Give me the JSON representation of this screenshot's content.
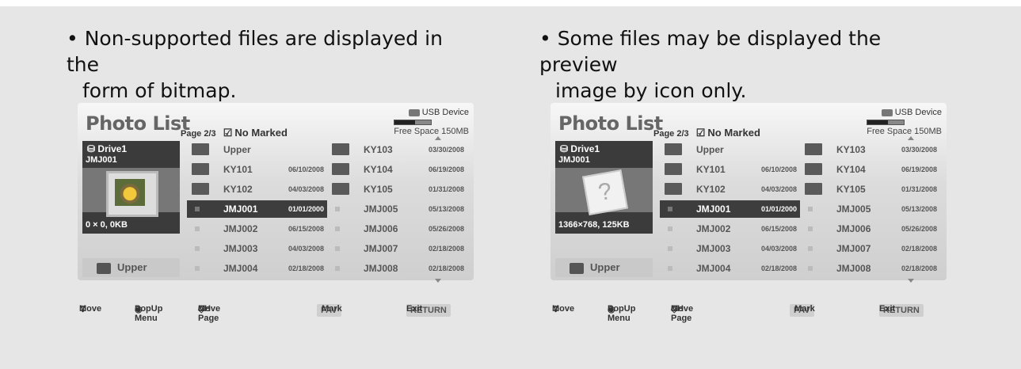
{
  "left": {
    "bullet_line1": "• Non-supported files are displayed in the",
    "bullet_line2": "form of bitmap.",
    "preview": {
      "drive": "Drive1",
      "file": "JMJ001",
      "info": "0 × 0, 0KB"
    }
  },
  "right": {
    "bullet_line1": "• Some files may be displayed the preview",
    "bullet_line2": "image by icon only.",
    "preview": {
      "drive": "Drive1",
      "file": "JMJ001",
      "info": "1366×768, 125KB",
      "thumb_glyph": "?"
    }
  },
  "screen": {
    "title": "Photo List",
    "page": "Page 2/3",
    "marked": "No Marked",
    "usb_label": "USB Device",
    "free_space": "Free Space 150MB",
    "upper_button": "Upper",
    "rows_left": [
      {
        "name": "Upper",
        "date": "",
        "kind": "up"
      },
      {
        "name": "KY101",
        "date": "06/10/2008",
        "kind": "folder"
      },
      {
        "name": "KY102",
        "date": "04/03/2008",
        "kind": "folder"
      },
      {
        "name": "JMJ001",
        "date": "01/01/2000",
        "kind": "file",
        "selected": true
      },
      {
        "name": "JMJ002",
        "date": "06/15/2008",
        "kind": "file"
      },
      {
        "name": "JMJ003",
        "date": "04/03/2008",
        "kind": "file"
      },
      {
        "name": "JMJ004",
        "date": "02/18/2008",
        "kind": "file"
      }
    ],
    "rows_right": [
      {
        "name": "KY103",
        "date": "03/30/2008",
        "kind": "folder"
      },
      {
        "name": "KY104",
        "date": "06/19/2008",
        "kind": "folder"
      },
      {
        "name": "KY105",
        "date": "01/31/2008",
        "kind": "folder"
      },
      {
        "name": "JMJ005",
        "date": "05/13/2008",
        "kind": "file"
      },
      {
        "name": "JMJ006",
        "date": "05/26/2008",
        "kind": "file"
      },
      {
        "name": "JMJ007",
        "date": "02/18/2008",
        "kind": "file"
      },
      {
        "name": "JMJ008",
        "date": "02/18/2008",
        "kind": "file"
      }
    ],
    "bottom": {
      "move": "Move",
      "popup": "PopUp Menu",
      "ch": "CH",
      "move_page": "Move Page",
      "fav": "FAV",
      "mark": "Mark",
      "return": "RETURN",
      "exit": "Exit"
    }
  }
}
